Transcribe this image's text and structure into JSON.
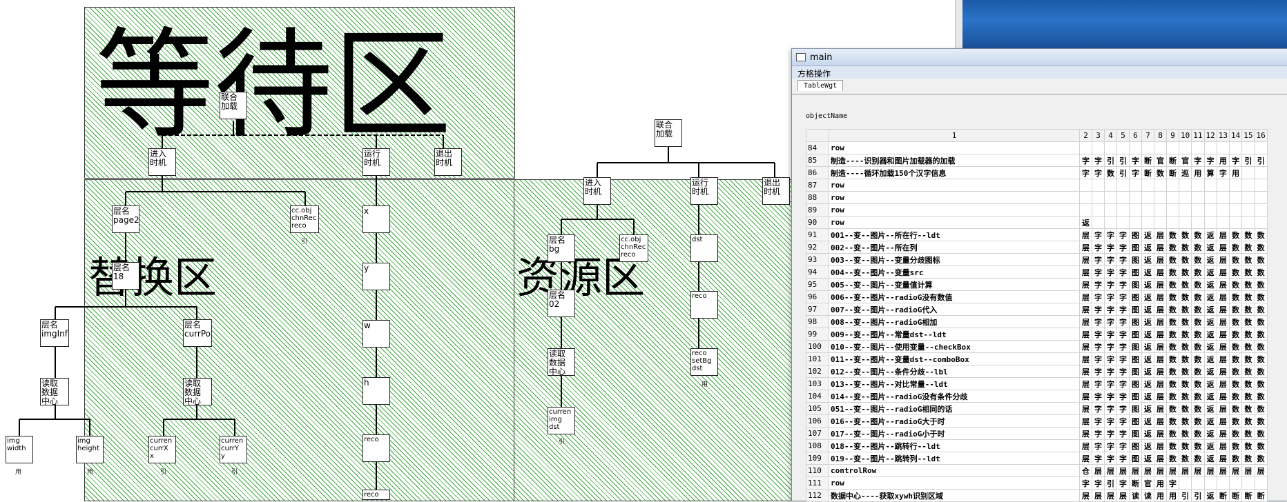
{
  "zones": {
    "wait": "等待区",
    "swap": "替换区",
    "res": "资源区"
  },
  "nodes": {
    "joint_load_1": "联合\n加载",
    "enter_1": "进入\n时机",
    "run_1": "运行\n时机",
    "exit_1": "退出\n时机",
    "layer_page2": "层名\npage2",
    "ccobj_1": "cc.obj\nchnRec\nreco",
    "x": "x",
    "y": "y",
    "w": "w",
    "h": "h",
    "reco_1": "reco",
    "reco_2": "reco",
    "layer_18": "层名\n18",
    "layer_imginf": "层名\nimgInf",
    "layer_currpo": "层名\ncurrPo",
    "read_center_1": "读取\n数据\n中心",
    "read_center_2": "读取\n数据\n中心",
    "img_width": "img\nwidth",
    "img_height": "img\nheight",
    "curr_x": "curren\ncurrX\nx",
    "curr_y": "curren\ncurrY\ny",
    "joint_load_2": "联合\n加载",
    "enter_2": "进入\n时机",
    "run_2": "运行\n时机",
    "exit_2": "退出\n时机",
    "layer_bg": "层名\nbg",
    "ccobj_2": "cc.obj\nchnRec\nreco",
    "dst": "dst",
    "reco_3": "reco",
    "reco_setbg": "reco\nsetBg\ndst",
    "layer_02": "层名\n02",
    "read_center_3": "读取\n数据\n中心",
    "curr_img_dst": "curren\nimg\ndst"
  },
  "tags": {
    "yong": "用",
    "yin": "引"
  },
  "window": {
    "title": "main",
    "menu": "方格操作",
    "tab": "TableWgt",
    "objectName": "objectName"
  },
  "grid": {
    "headers": [
      "1",
      "2",
      "3",
      "4",
      "5",
      "6",
      "7",
      "8",
      "9",
      "10",
      "11",
      "12",
      "13",
      "14",
      "15",
      "16"
    ],
    "rows": [
      {
        "n": "84",
        "t": "row",
        "c": ""
      },
      {
        "n": "85",
        "t": "制造----识别器和图片加载器的加载",
        "c": "字字引引字断官断官字字用字引引"
      },
      {
        "n": "86",
        "t": "制造----循环加载150个汉字信息",
        "c": "字字数引字断数断巡用算字用"
      },
      {
        "n": "87",
        "t": "row",
        "c": ""
      },
      {
        "n": "88",
        "t": "row",
        "c": ""
      },
      {
        "n": "89",
        "t": "row",
        "c": ""
      },
      {
        "n": "90",
        "t": "row",
        "c": "返"
      },
      {
        "n": "91",
        "t": "001--变--图片--所在行--ldt",
        "c": "层字字字图返层数数数返层数数数"
      },
      {
        "n": "92",
        "t": "002--变--图片--所在列",
        "c": "层字字字图返层数数数返层数数数"
      },
      {
        "n": "93",
        "t": "003--变--图片--变量分歧图标",
        "c": "层字字字图返层数数数返层数数数"
      },
      {
        "n": "94",
        "t": "004--变--图片--变量src",
        "c": "层字字字图返层数数数返层数数数"
      },
      {
        "n": "95",
        "t": "005--变--图片--变量值计算",
        "c": "层字字字图返层数数数返层数数数"
      },
      {
        "n": "96",
        "t": "006--变--图片--radioG没有数值",
        "c": "层字字字图返层数数数返层数数数"
      },
      {
        "n": "97",
        "t": "007--变--图片--radioG代入",
        "c": "层字字字图返层数数数返层数数数"
      },
      {
        "n": "98",
        "t": "008--变--图片--radioG相加",
        "c": "层字字字图返层数数数返层数数数"
      },
      {
        "n": "99",
        "t": "009--变--图片--常量dst--ldt",
        "c": "层字字字图返层数数数返层数数数"
      },
      {
        "n": "100",
        "t": "010--变--图片--使用变量--checkBox",
        "c": "层字字字图返层数数数返层数数数"
      },
      {
        "n": "101",
        "t": "011--变--图片--变量dst--comboBox",
        "c": "层字字字图返层数数数返层数数数"
      },
      {
        "n": "102",
        "t": "012--变--图片--条件分歧--lbl",
        "c": "层字字字图返层数数数返层数数数"
      },
      {
        "n": "103",
        "t": "013--变--图片--对比常量--ldt",
        "c": "层字字字图返层数数数返层数数数"
      },
      {
        "n": "104",
        "t": "014--变--图片--radioG没有条件分歧",
        "c": "层字字字图返层数数数返层数数数"
      },
      {
        "n": "105",
        "t": "051--变--图片--radioG相同的话",
        "c": "层字字字图返层数数数返层数数数"
      },
      {
        "n": "106",
        "t": "016--变--图片--radioG大于时",
        "c": "层字字字图返层数数数返层数数数"
      },
      {
        "n": "107",
        "t": "017--变--图片--radioG小于时",
        "c": "层字字字图返层数数数返层数数数"
      },
      {
        "n": "108",
        "t": "018--变--图片--跳转行--ldt",
        "c": "层字字字图返层数数数返层数数数"
      },
      {
        "n": "109",
        "t": "019--变--图片--跳转列--ldt",
        "c": "层字字字图返层数数数返层数数数"
      },
      {
        "n": "110",
        "t": "controlRow",
        "c": "仓层层层层层层层层层层层层层层"
      },
      {
        "n": "111",
        "t": "row",
        "c": "字字引字断官用字"
      },
      {
        "n": "112",
        "t": "数据中心----获取xywh识别区域",
        "c": "层层层层读读用用引引返断断断断"
      }
    ]
  }
}
